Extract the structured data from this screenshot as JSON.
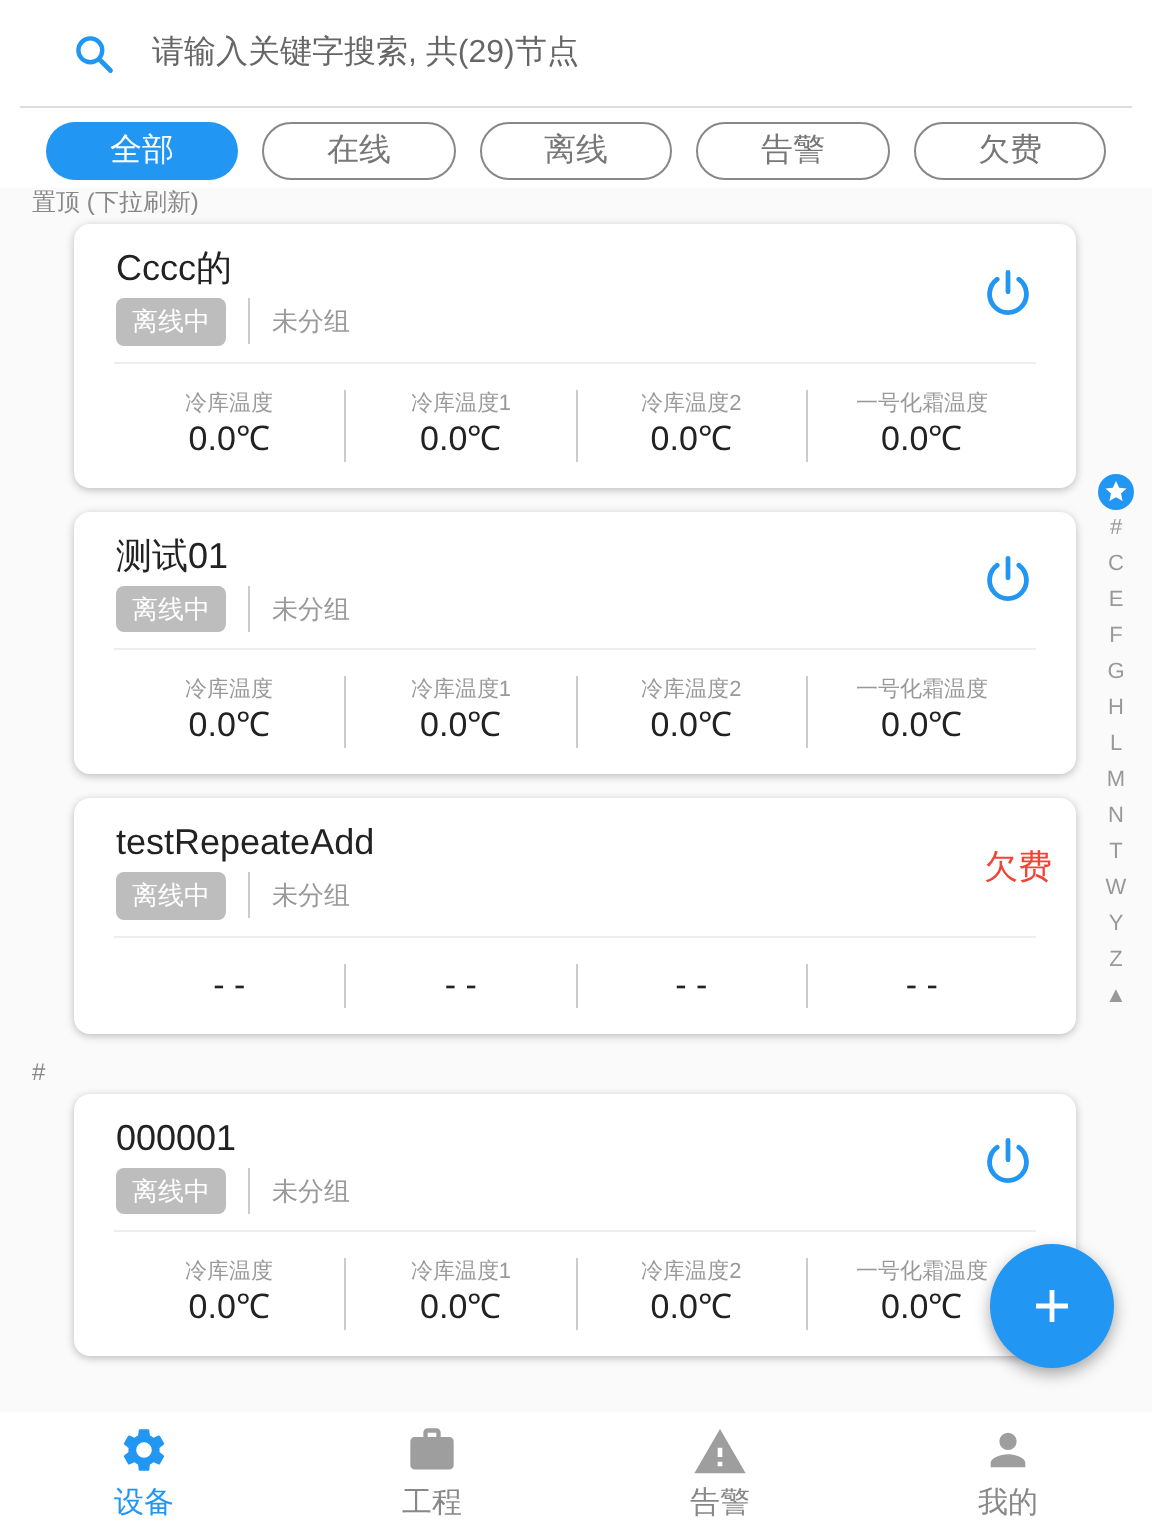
{
  "search": {
    "placeholder": "请输入关键字搜索, 共(29)节点"
  },
  "filters": [
    {
      "label": "全部",
      "selected": true
    },
    {
      "label": "在线",
      "selected": false
    },
    {
      "label": "离线",
      "selected": false
    },
    {
      "label": "告警",
      "selected": false
    },
    {
      "label": "欠费",
      "selected": false
    }
  ],
  "sections": [
    {
      "header": "置顶 (下拉刷新)",
      "cards": [
        {
          "name": "Cccc的",
          "status": "离线中",
          "group": "未分组",
          "action": {
            "kind": "power"
          },
          "metrics": [
            {
              "label": "冷库温度",
              "value": "0.0℃"
            },
            {
              "label": "冷库温度1",
              "value": "0.0℃"
            },
            {
              "label": "冷库温度2",
              "value": "0.0℃"
            },
            {
              "label": "一号化霜温度",
              "value": "0.0℃"
            }
          ]
        },
        {
          "name": "测试01",
          "status": "离线中",
          "group": "未分组",
          "action": {
            "kind": "power"
          },
          "metrics": [
            {
              "label": "冷库温度",
              "value": "0.0℃"
            },
            {
              "label": "冷库温度1",
              "value": "0.0℃"
            },
            {
              "label": "冷库温度2",
              "value": "0.0℃"
            },
            {
              "label": "一号化霜温度",
              "value": "0.0℃"
            }
          ]
        },
        {
          "name": "testRepeateAdd",
          "status": "离线中",
          "group": "未分组",
          "action": {
            "kind": "text",
            "text": "欠费"
          },
          "metrics": [
            {
              "value": "- -"
            },
            {
              "value": "- -"
            },
            {
              "value": "- -"
            },
            {
              "value": "- -"
            }
          ]
        }
      ]
    },
    {
      "header": "#",
      "cards": [
        {
          "name": "000001",
          "status": "离线中",
          "group": "未分组",
          "action": {
            "kind": "power"
          },
          "metrics": [
            {
              "label": "冷库温度",
              "value": "0.0℃"
            },
            {
              "label": "冷库温度1",
              "value": "0.0℃"
            },
            {
              "label": "冷库温度2",
              "value": "0.0℃"
            },
            {
              "label": "一号化霜温度",
              "value": "0.0℃"
            }
          ]
        }
      ]
    }
  ],
  "index": [
    {
      "kind": "star",
      "selected": true
    },
    {
      "label": "#",
      "selected": false
    },
    {
      "label": "C",
      "selected": false
    },
    {
      "label": "E",
      "selected": false
    },
    {
      "label": "F",
      "selected": false
    },
    {
      "label": "G",
      "selected": false
    },
    {
      "label": "H",
      "selected": false
    },
    {
      "label": "L",
      "selected": false
    },
    {
      "label": "M",
      "selected": false
    },
    {
      "label": "N",
      "selected": false
    },
    {
      "label": "T",
      "selected": false
    },
    {
      "label": "W",
      "selected": false
    },
    {
      "label": "Y",
      "selected": false
    },
    {
      "label": "Z",
      "selected": false
    },
    {
      "label": "▲",
      "selected": false
    }
  ],
  "fab": {
    "kind": "add"
  },
  "nav": [
    {
      "kind": "gear",
      "label": "设备",
      "selected": true
    },
    {
      "kind": "briefcase",
      "label": "工程",
      "selected": false
    },
    {
      "kind": "warning",
      "label": "告警",
      "selected": false
    },
    {
      "kind": "person",
      "label": "我的",
      "selected": false
    }
  ]
}
